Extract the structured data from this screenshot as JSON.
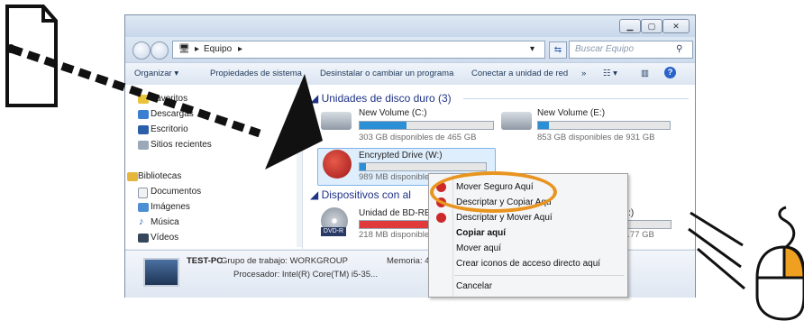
{
  "address": {
    "path_label": "Equipo",
    "search_placeholder": "Buscar Equipo"
  },
  "toolbar": {
    "organize": "Organizar ▾",
    "system_props": "Propiedades de sistema",
    "uninstall": "Desinstalar o cambiar un programa",
    "map_drive": "Conectar a unidad de red",
    "more": "»"
  },
  "sidebar": {
    "favorites": "Favoritos",
    "downloads": "Descargas",
    "desktop": "Escritorio",
    "recent": "Sitios recientes",
    "libraries": "Bibliotecas",
    "documents": "Documentos",
    "images": "Imágenes",
    "music": "Música",
    "videos": "Vídeos"
  },
  "content": {
    "hdd_group": "Unidades de disco duro (3)",
    "devices_group": "Dispositivos con al",
    "drive_c": {
      "name": "New Volume (C:)",
      "free": "303 GB disponibles de 465 GB",
      "used_fraction": 0.35
    },
    "drive_e": {
      "name": "New Volume (E:)",
      "free": "853 GB disponibles de 931 GB",
      "used_fraction": 0.08
    },
    "drive_w": {
      "name": "Encrypted Drive (W:)",
      "free": "989 MB disponibles de 9",
      "used_fraction": 0.05
    },
    "bd": {
      "name": "Unidad de BD-RE (",
      "free": "218 MB disponibles",
      "label": "DVD-R",
      "used_fraction": 0.98
    },
    "f_partial": {
      "name": "F:)",
      "free": "3.77 GB"
    }
  },
  "details": {
    "pc_name": "TEST-PC",
    "workgroup": "Grupo de trabajo: WORKGROUP",
    "processor": "Procesador: Intel(R) Core(TM) i5-35...",
    "memory": "Memoria: 4"
  },
  "context_menu": {
    "items": [
      "Mover Seguro Aquí",
      "Descriptar y Copiar Aqu",
      "Descriptar y Mover Aquí",
      "Copiar aquí",
      "Mover aquí",
      "Crear iconos de acceso directo aquí",
      "Cancelar"
    ]
  },
  "colors": {
    "highlight": "#e8941e",
    "drive_fill": "#2b8fd6",
    "bd_fill": "#e13a3a",
    "mouse_button": "#f0a020"
  }
}
